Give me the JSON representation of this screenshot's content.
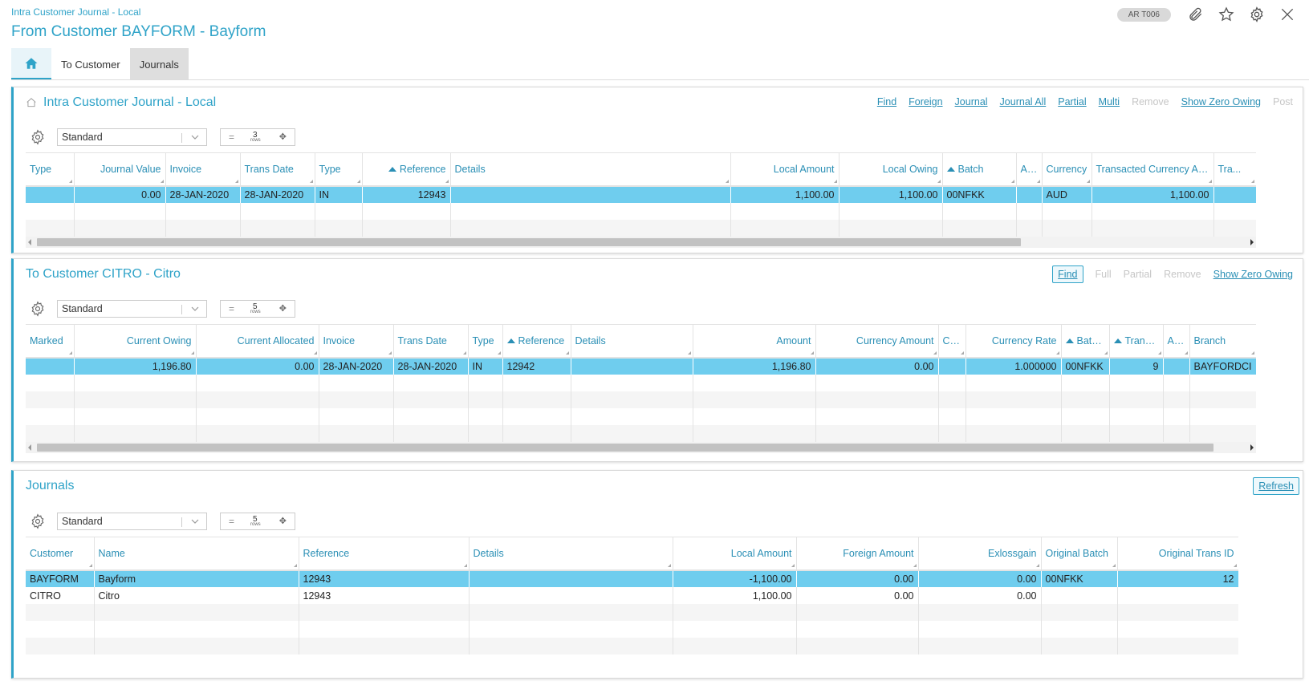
{
  "breadcrumb": "Intra Customer Journal - Local",
  "title": "From Customer BAYFORM - Bayform",
  "header": {
    "badge": "AR T006"
  },
  "tabs": [
    {
      "label": "To Customer"
    },
    {
      "label": "Journals"
    }
  ],
  "panel1": {
    "title": "Intra Customer Journal - Local",
    "actions": [
      "Find",
      "Foreign",
      "Journal",
      "Journal All",
      "Partial",
      "Multi",
      "Remove",
      "Show Zero Owing",
      "Post"
    ],
    "view": "Standard",
    "rows": "3",
    "rows_label": "rows",
    "columns": [
      "Type",
      "Journal Value",
      "Invoice",
      "Trans Date",
      "Type",
      "Reference",
      "Details",
      "Local Amount",
      "Local Owing",
      "Batch",
      "Age",
      "Currency",
      "Transacted Currency Am...",
      "Tra..."
    ],
    "data": [
      [
        "",
        "0.00",
        "28-JAN-2020",
        "28-JAN-2020",
        "IN",
        "12943",
        "",
        "1,100.00",
        "1,100.00",
        "00NFKK",
        "",
        "AUD",
        "1,100.00",
        ""
      ]
    ]
  },
  "panel2": {
    "title": "To Customer CITRO - Citro",
    "actions": [
      "Find",
      "Full",
      "Partial",
      "Remove",
      "Show Zero Owing"
    ],
    "view": "Standard",
    "rows": "5",
    "rows_label": "rows",
    "columns": [
      "Marked",
      "Current Owing",
      "Current Allocated",
      "Invoice",
      "Trans Date",
      "Type",
      "Reference",
      "Details",
      "Amount",
      "Currency Amount",
      "Cu...",
      "Currency Rate",
      "Batc...",
      "Trans ...",
      "Age",
      "Branch"
    ],
    "data": [
      [
        "",
        "1,196.80",
        "0.00",
        "28-JAN-2020",
        "28-JAN-2020",
        "IN",
        "12942",
        "",
        "1,196.80",
        "0.00",
        "",
        "1.000000",
        "00NFKK",
        "9",
        "",
        "BAYFORDCI"
      ]
    ]
  },
  "panel3": {
    "title": "Journals",
    "actions": [
      "Refresh"
    ],
    "view": "Standard",
    "rows": "5",
    "rows_label": "rows",
    "columns": [
      "Customer",
      "Name",
      "Reference",
      "Details",
      "Local Amount",
      "Foreign Amount",
      "Exlossgain",
      "Original Batch",
      "Original Trans ID"
    ],
    "data": [
      [
        "BAYFORM",
        "Bayform",
        "12943",
        "",
        "-1,100.00",
        "0.00",
        "0.00",
        "00NFKK",
        "12"
      ],
      [
        "CITRO",
        "Citro",
        "12943",
        "",
        "1,100.00",
        "0.00",
        "0.00",
        "",
        ""
      ]
    ]
  }
}
